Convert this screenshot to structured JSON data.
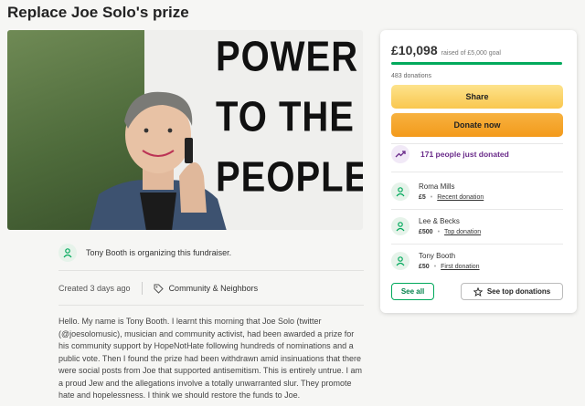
{
  "page": {
    "title": "Replace Joe Solo's prize"
  },
  "hero": {
    "sign_lines": [
      "POWER",
      "TO THE",
      "PEOPLE!"
    ]
  },
  "organizer": {
    "text": "Tony Booth is organizing this fundraiser."
  },
  "meta": {
    "created": "Created 3 days ago",
    "category": "Community & Neighbors"
  },
  "story": {
    "text": "Hello. My name is Tony Booth. I learnt this morning that Joe Solo (twitter (@joesolomusic), musician and community activist, had been awarded a prize for his community support by HopeNotHate following hundreds of nominations and a public vote. Then I found the prize had been withdrawn amid insinuations that there were social posts from Joe that supported antisemitism. This is entirely untrue. I am a proud Jew and the allegations involve a totally unwarranted slur. They promote hate and hopelessness. I think we should restore the funds to Joe."
  },
  "donation_card": {
    "amount": "£10,098",
    "goal_text": "raised of £5,000 goal",
    "progress_fraction": 1.0,
    "donations_count": "483 donations",
    "share_label": "Share",
    "donate_label": "Donate now",
    "trend_text": "171 people just donated",
    "donors": [
      {
        "name": "Roma Mills",
        "amount": "£5",
        "tag": "Recent donation"
      },
      {
        "name": "Lee & Becks",
        "amount": "£500",
        "tag": "Top donation"
      },
      {
        "name": "Tony Booth",
        "amount": "£50",
        "tag": "First donation"
      }
    ],
    "see_all_label": "See all",
    "see_top_label": "See top donations"
  },
  "colors": {
    "accent_green": "#02a95c",
    "donate_orange": "#f39a1b",
    "share_yellow": "#f9c74f",
    "trend_purple": "#6a2b8a"
  },
  "icons": [
    "user-heart-icon",
    "tag-icon",
    "trending-up-icon",
    "star-icon"
  ]
}
